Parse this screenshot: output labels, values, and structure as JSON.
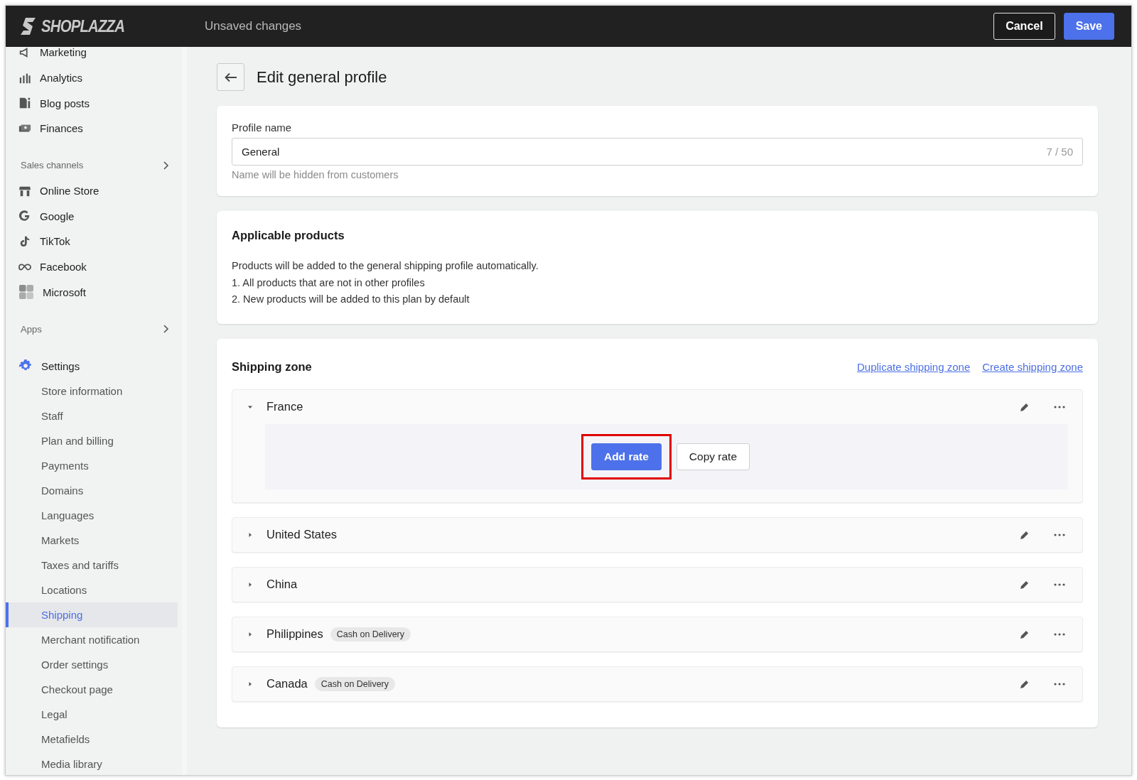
{
  "header": {
    "logo": "SHOPLAZZA",
    "status": "Unsaved changes",
    "buttons": [
      {
        "label": "Cancel",
        "kind": "secondary"
      },
      {
        "label": "Save",
        "kind": "primary"
      }
    ]
  },
  "sidebar": {
    "groups": [
      {
        "kind": "plain",
        "items": [
          {
            "label": "Marketing",
            "selected": false
          },
          {
            "label": "Analytics",
            "selected": false
          },
          {
            "label": "Blog posts",
            "selected": false
          },
          {
            "label": "Finances",
            "selected": false
          }
        ]
      },
      {
        "kind": "section",
        "title": "Sales channels",
        "items": [
          {
            "label": "Online Store",
            "selected": false
          },
          {
            "label": "Google",
            "selected": false
          },
          {
            "label": "TikTok",
            "selected": false
          },
          {
            "label": "Facebook",
            "selected": false
          },
          {
            "label": "Microsoft",
            "selected": false
          }
        ]
      },
      {
        "kind": "section",
        "title": "Apps"
      },
      {
        "kind": "tree",
        "title": "Settings",
        "items": [
          {
            "label": "Store information",
            "selected": false
          },
          {
            "label": "Staff",
            "selected": false
          },
          {
            "label": "Plan and billing",
            "selected": false
          },
          {
            "label": "Payments",
            "selected": false
          },
          {
            "label": "Domains",
            "selected": false
          },
          {
            "label": "Languages",
            "selected": false
          },
          {
            "label": "Markets",
            "selected": false
          },
          {
            "label": "Taxes and tariffs",
            "selected": false
          },
          {
            "label": "Locations",
            "selected": false
          },
          {
            "label": "Shipping",
            "selected": true
          },
          {
            "label": "Merchant notification",
            "selected": false
          },
          {
            "label": "Order settings",
            "selected": false
          },
          {
            "label": "Checkout page",
            "selected": false
          },
          {
            "label": "Legal",
            "selected": false
          },
          {
            "label": "Metafields",
            "selected": false
          },
          {
            "label": "Media library",
            "selected": false
          }
        ]
      }
    ]
  },
  "page": {
    "title": "Edit general profile"
  },
  "profile": {
    "label": "Profile name",
    "value": "General",
    "counter": "7 / 50",
    "help": "Name will be hidden from customers"
  },
  "products": {
    "title": "Applicable products",
    "lines": [
      "Products will be added to the general shipping profile automatically.",
      "1. All products that are not in other profiles",
      "2. New products will be added to this plan by default"
    ]
  },
  "zones": {
    "title": "Shipping zone",
    "links": [
      "Duplicate shipping zone",
      "Create shipping zone"
    ],
    "items": [
      {
        "name": "France",
        "expanded": true,
        "actions": [
          {
            "label": "Add rate",
            "kind": "primary",
            "highlighted": true
          },
          {
            "label": "Copy rate",
            "kind": "secondary",
            "highlighted": false
          }
        ]
      },
      {
        "name": "United States",
        "expanded": false
      },
      {
        "name": "China",
        "expanded": false
      },
      {
        "name": "Philippines",
        "expanded": false,
        "tag": "Cash on Delivery"
      },
      {
        "name": "Canada",
        "expanded": false,
        "tag": "Cash on Delivery"
      }
    ]
  }
}
